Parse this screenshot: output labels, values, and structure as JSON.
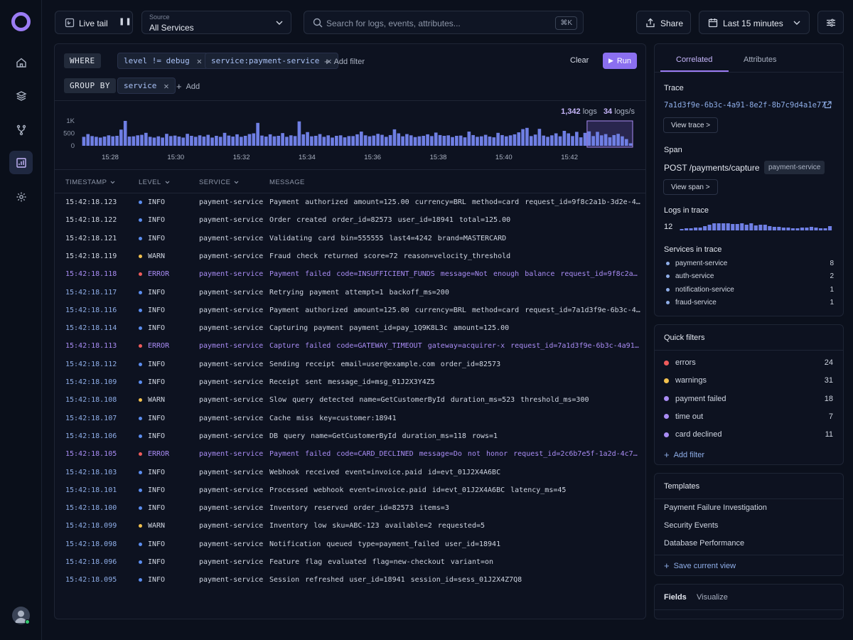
{
  "topbar": {
    "live_tail_label": "Live tail",
    "source_label": "Source",
    "source_value": "All Services",
    "search_placeholder": "Search for logs, events, attributes...",
    "search_shortcut": "⌘K",
    "share_label": "Share",
    "time_range_label": "Last 15 minutes"
  },
  "query": {
    "where_label": "WHERE",
    "filters": [
      "level != debug",
      "service:payment-service"
    ],
    "add_filter_label": "Add filter",
    "clear_label": "Clear",
    "run_label": "Run",
    "group_by_label": "GROUP BY",
    "group_by": [
      "service"
    ],
    "add_label": "Add"
  },
  "histogram": {
    "total_logs": "1,342",
    "logs_unit": "logs",
    "rate": "34",
    "rate_unit": "logs/s",
    "y_ticks": [
      "1K",
      "500",
      "0"
    ],
    "x_ticks": [
      "15:28",
      "15:30",
      "15:32",
      "15:34",
      "15:36",
      "15:38",
      "15:40",
      "15:42"
    ],
    "values": [
      360,
      470,
      390,
      360,
      330,
      370,
      420,
      380,
      400,
      650,
      1000,
      370,
      380,
      420,
      440,
      520,
      360,
      330,
      380,
      330,
      480,
      390,
      410,
      370,
      330,
      480,
      400,
      360,
      420,
      370,
      440,
      330,
      400,
      360,
      520,
      410,
      370,
      460,
      360,
      400,
      470,
      500,
      920,
      410,
      370,
      460,
      380,
      400,
      510,
      360,
      420,
      390,
      980,
      460,
      550,
      380,
      400,
      470,
      360,
      420,
      330,
      400,
      420,
      340,
      390,
      390,
      460,
      570,
      420,
      380,
      410,
      480,
      440,
      360,
      430,
      660,
      500,
      380,
      470,
      420,
      350,
      380,
      400,
      460,
      390,
      530,
      430,
      400,
      420,
      350,
      400,
      410,
      340,
      570,
      430,
      360,
      380,
      440,
      370,
      340,
      520,
      430,
      380,
      420,
      460,
      540,
      670,
      720,
      390,
      450,
      680,
      410,
      360,
      420,
      500,
      380,
      600,
      500,
      390,
      560,
      340,
      520,
      580,
      390,
      560,
      420,
      470,
      340,
      430,
      480,
      380,
      270,
      100
    ],
    "ymax": 1000
  },
  "table": {
    "columns": [
      "TIMESTAMP",
      "LEVEL",
      "SERVICE",
      "MESSAGE"
    ],
    "rows": [
      {
        "ts": "15:42:18.123",
        "level": "INFO",
        "service": "payment-service",
        "message": "Payment authorized  amount=125.00  currency=BRL  method=card  request_id=9f8c2a1b-3d2e-4f10..."
      },
      {
        "ts": "15:42:18.122",
        "level": "INFO",
        "service": "payment-service",
        "message": "Order created  order_id=82573  user_id=18941  total=125.00"
      },
      {
        "ts": "15:42:18.121",
        "level": "INFO",
        "service": "payment-service",
        "message": "Validating card  bin=555555  last4=4242  brand=MASTERCARD"
      },
      {
        "ts": "15:42:18.119",
        "level": "WARN",
        "service": "payment-service",
        "message": "Fraud check returned  score=72  reason=velocity_threshold"
      },
      {
        "ts": "15:42:18.118",
        "level": "ERROR",
        "service": "payment-service",
        "message": "Payment failed  code=INSUFFICIENT_FUNDS  message=Not enough balance  request_id=9f8c2a1b-3..."
      },
      {
        "ts": "15:42:18.117",
        "level": "INFO",
        "service": "payment-service",
        "message": "Retrying payment  attempt=1  backoff_ms=200"
      },
      {
        "ts": "15:42:18.116",
        "level": "INFO",
        "service": "payment-service",
        "message": "Payment authorized  amount=125.00  currency=BRL  method=card  request_id=7a1d3f9e-6b3c-4a9..."
      },
      {
        "ts": "15:42:18.114",
        "level": "INFO",
        "service": "payment-service",
        "message": "Capturing payment  payment_id=pay_1Q9K8L3c  amount=125.00"
      },
      {
        "ts": "15:42:18.113",
        "level": "ERROR",
        "service": "payment-service",
        "message": "Capture failed  code=GATEWAY_TIMEOUT  gateway=acquirer-x  request_id=7a1d3f9e-6b3c-4a91-8..."
      },
      {
        "ts": "15:42:18.112",
        "level": "INFO",
        "service": "payment-service",
        "message": "Sending receipt  email=user@example.com  order_id=82573"
      },
      {
        "ts": "15:42:18.109",
        "level": "INFO",
        "service": "payment-service",
        "message": "Receipt sent  message_id=msg_01J2X3Y4Z5"
      },
      {
        "ts": "15:42:18.108",
        "level": "WARN",
        "service": "payment-service",
        "message": "Slow query detected  name=GetCustomerById  duration_ms=523  threshold_ms=300"
      },
      {
        "ts": "15:42:18.107",
        "level": "INFO",
        "service": "payment-service",
        "message": "Cache miss  key=customer:18941"
      },
      {
        "ts": "15:42:18.106",
        "level": "INFO",
        "service": "payment-service",
        "message": "DB query  name=GetCustomerById  duration_ms=118  rows=1"
      },
      {
        "ts": "15:42:18.105",
        "level": "ERROR",
        "service": "payment-service",
        "message": "Payment failed  code=CARD_DECLINED  message=Do not honor  request_id=2c6b7e5f-1a2d-4c7b-9..."
      },
      {
        "ts": "15:42:18.103",
        "level": "INFO",
        "service": "payment-service",
        "message": "Webhook received  event=invoice.paid  id=evt_01J2X4A6BC"
      },
      {
        "ts": "15:42:18.101",
        "level": "INFO",
        "service": "payment-service",
        "message": "Processed webhook  event=invoice.paid  id=evt_01J2X4A6BC  latency_ms=45"
      },
      {
        "ts": "15:42:18.100",
        "level": "INFO",
        "service": "payment-service",
        "message": "Inventory reserved  order_id=82573  items=3"
      },
      {
        "ts": "15:42:18.099",
        "level": "WARN",
        "service": "payment-service",
        "message": "Inventory low  sku=ABC-123  available=2  requested=5"
      },
      {
        "ts": "15:42:18.098",
        "level": "INFO",
        "service": "payment-service",
        "message": "Notification queued  type=payment_failed  user_id=18941"
      },
      {
        "ts": "15:42:18.096",
        "level": "INFO",
        "service": "payment-service",
        "message": "Feature flag evaluated  flag=new-checkout  variant=on"
      },
      {
        "ts": "15:42:18.095",
        "level": "INFO",
        "service": "payment-service",
        "message": "Session refreshed  user_id=18941  session_id=sess_01J2X4Z7Q8"
      }
    ]
  },
  "level_colors": {
    "INFO": "#5b8def",
    "WARN": "#f2c14e",
    "ERROR": "#ef5b5b"
  },
  "correlated": {
    "tabs": [
      "Correlated",
      "Attributes"
    ],
    "trace_label": "Trace",
    "trace_id": "7a1d3f9e-6b3c-4a91-8e2f-8b7c9d4a1e77",
    "view_trace_label": "View trace >",
    "span_label": "Span",
    "span_name": "POST /payments/capture",
    "span_service": "payment-service",
    "view_span_label": "View span >",
    "logs_in_trace_label": "Logs in trace",
    "logs_in_trace_count": "12",
    "services_label": "Services in trace",
    "services": [
      {
        "name": "payment-service",
        "count": "8"
      },
      {
        "name": "auth-service",
        "count": "2"
      },
      {
        "name": "notification-service",
        "count": "1"
      },
      {
        "name": "fraud-service",
        "count": "1"
      }
    ]
  },
  "quick_filters": {
    "title": "Quick filters",
    "items": [
      {
        "name": "errors",
        "count": "24",
        "color": "#ef5b5b"
      },
      {
        "name": "warnings",
        "count": "31",
        "color": "#f2c14e"
      },
      {
        "name": "payment failed",
        "count": "18",
        "color": "#a98cf4"
      },
      {
        "name": "time out",
        "count": "7",
        "color": "#a98cf4"
      },
      {
        "name": "card declined",
        "count": "11",
        "color": "#a98cf4"
      }
    ],
    "add_filter_label": "Add filter"
  },
  "templates": {
    "title": "Templates",
    "items": [
      "Payment Failure Investigation",
      "Security Events",
      "Database Performance"
    ],
    "save_label": "Save current view"
  },
  "fields": {
    "tabs": [
      "Fields",
      "Visualize"
    ]
  }
}
